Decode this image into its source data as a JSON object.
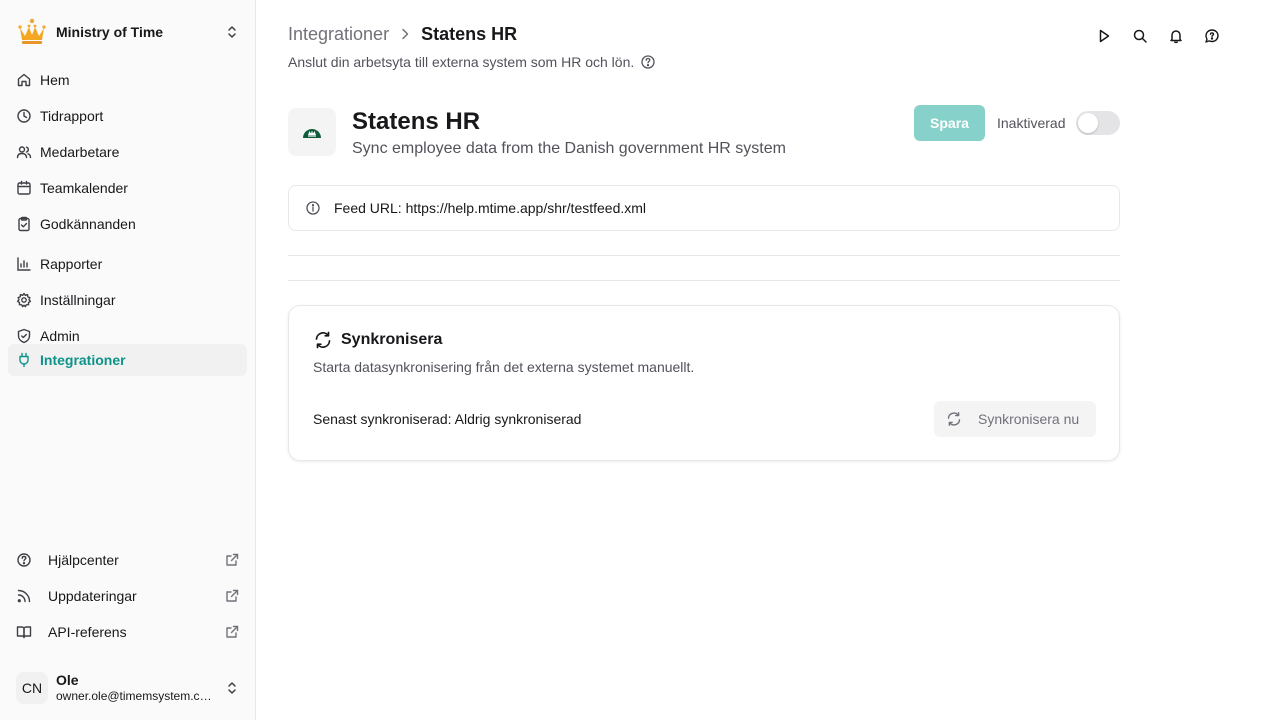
{
  "workspace": {
    "name": "Ministry of Time",
    "logo_icon": "crown-icon"
  },
  "nav": [
    {
      "label": "Hem",
      "icon": "home-icon"
    },
    {
      "label": "Tidrapport",
      "icon": "clock-icon"
    },
    {
      "label": "Medarbetare",
      "icon": "users-icon"
    },
    {
      "label": "Teamkalender",
      "icon": "calendar-icon"
    },
    {
      "label": "Godkännanden",
      "icon": "clipboard-check-icon"
    },
    {
      "label": "Rapporter",
      "icon": "chart-icon"
    },
    {
      "label": "Inställningar",
      "icon": "gear-icon"
    },
    {
      "label": "Admin",
      "icon": "shield-icon"
    },
    {
      "label": "Integrationer",
      "icon": "plug-icon",
      "active": true
    }
  ],
  "footer_links": [
    {
      "label": "Hjälpcenter",
      "icon": "help-circle-icon"
    },
    {
      "label": "Uppdateringar",
      "icon": "rss-icon"
    },
    {
      "label": "API-referens",
      "icon": "book-icon"
    }
  ],
  "user": {
    "initials": "CN",
    "name": "Ole",
    "email": "owner.ole@timemsystem.com"
  },
  "breadcrumb": {
    "parent": "Integrationer",
    "current": "Statens HR"
  },
  "page_subtitle": "Anslut din arbetsyta till externa system som HR och lön.",
  "integration": {
    "title": "Statens HR",
    "description": "Sync employee data from the Danish government HR system",
    "save_label": "Spara",
    "status_label": "Inaktiverad",
    "enabled": false
  },
  "feed": {
    "text": "Feed URL: https://help.mtime.app/shr/testfeed.xml"
  },
  "sync": {
    "title": "Synkronisera",
    "description": "Starta datasynkronisering från det externa systemet manuellt.",
    "last_synced": "Senast synkroniserad: Aldrig synkroniserad",
    "button_label": "Synkronisera nu"
  },
  "colors": {
    "accent": "#0d9488",
    "save_disabled": "#86d2cb"
  }
}
